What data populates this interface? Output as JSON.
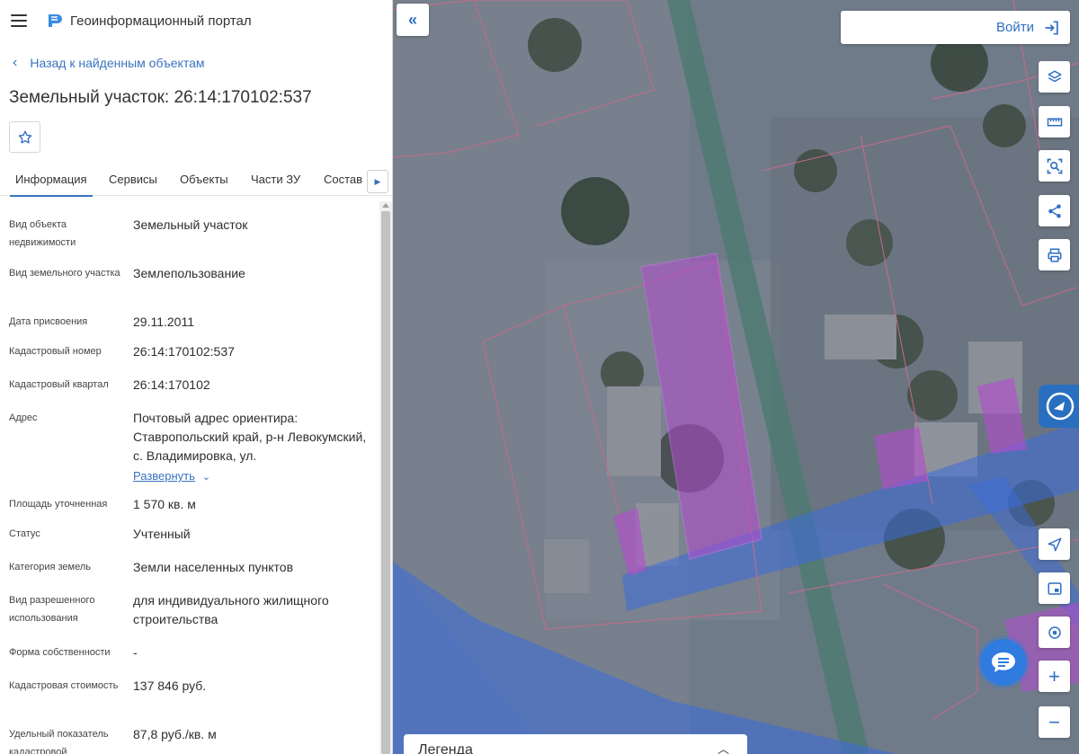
{
  "header": {
    "app_title": "Геоинформационный портал",
    "menu_icon": "menu-icon",
    "logo_icon": "portal-logo-icon"
  },
  "nav": {
    "back_label": "Назад к найденным объектам"
  },
  "object": {
    "title": "Земельный участок: 26:14:170102:537"
  },
  "tabs": [
    {
      "label": "Информация",
      "active": true
    },
    {
      "label": "Сервисы",
      "active": false
    },
    {
      "label": "Объекты",
      "active": false
    },
    {
      "label": "Части ЗУ",
      "active": false
    },
    {
      "label": "Состав",
      "active": false
    }
  ],
  "info": [
    {
      "label": "Вид объекта недвижимости",
      "value": "Земельный участок"
    },
    {
      "label": "Вид земельного участка",
      "value": "Землепользование"
    },
    {
      "label": "Дата присвоения",
      "value": "29.11.2011"
    },
    {
      "label": "Кадастровый номер",
      "value": "26:14:170102:537"
    },
    {
      "label": "Кадастровый квартал",
      "value": "26:14:170102"
    },
    {
      "label": "Адрес",
      "value": "Почтовый адрес ориентира: Ставропольский край, р-н Левокумский, с. Владимировка, ул.",
      "expand_label": "Развернуть"
    },
    {
      "label": "Площадь уточненная",
      "value": "1 570 кв. м"
    },
    {
      "label": "Статус",
      "value": "Учтенный"
    },
    {
      "label": "Категория земель",
      "value": "Земли населенных пунктов"
    },
    {
      "label": "Вид разрешенного использования",
      "value": "для индивидуального жилищного строительства"
    },
    {
      "label": "Форма собственности",
      "value": "-"
    },
    {
      "label": "Кадастровая стоимость",
      "value": "137 846 руб."
    },
    {
      "label": "Удельный показатель кадастровой",
      "value": "87,8 руб./кв. м"
    }
  ],
  "map": {
    "login_label": "Войти",
    "legend_label": "Легенда",
    "tools": [
      "layers-icon",
      "ruler-icon",
      "area-select-icon",
      "share-icon",
      "print-icon",
      "locate-arrow-icon",
      "minimap-icon",
      "geolocation-icon",
      "zoom-in-icon",
      "zoom-out-icon"
    ],
    "colors": {
      "accent": "#2f6ec3",
      "parcel_highlight": "#b44bd0",
      "zone_blue": "#3a6cdc"
    }
  }
}
